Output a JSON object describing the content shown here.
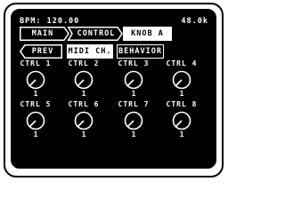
{
  "status": {
    "bpm": "BPM: 120.00",
    "sample_rate": "48.0k"
  },
  "nav": {
    "breadcrumb": [
      "MAIN",
      "CONTROL",
      "KNOB A"
    ],
    "prev_label": "PREV",
    "tabs": [
      {
        "label": "MIDI CH.",
        "active": true
      },
      {
        "label": "BEHAVIOR",
        "active": false
      }
    ]
  },
  "knobs": [
    {
      "label": "CTRL 1",
      "value": "1"
    },
    {
      "label": "CTRL 2",
      "value": "1"
    },
    {
      "label": "CTRL 3",
      "value": "1"
    },
    {
      "label": "CTRL 4",
      "value": "1"
    },
    {
      "label": "CTRL 5",
      "value": "1"
    },
    {
      "label": "CTRL 6",
      "value": "1"
    },
    {
      "label": "CTRL 7",
      "value": "1"
    },
    {
      "label": "CTRL 8",
      "value": "1"
    }
  ],
  "colors": {
    "screen": "#000000",
    "foreground": "#ffffff",
    "bezel": "#000000"
  }
}
